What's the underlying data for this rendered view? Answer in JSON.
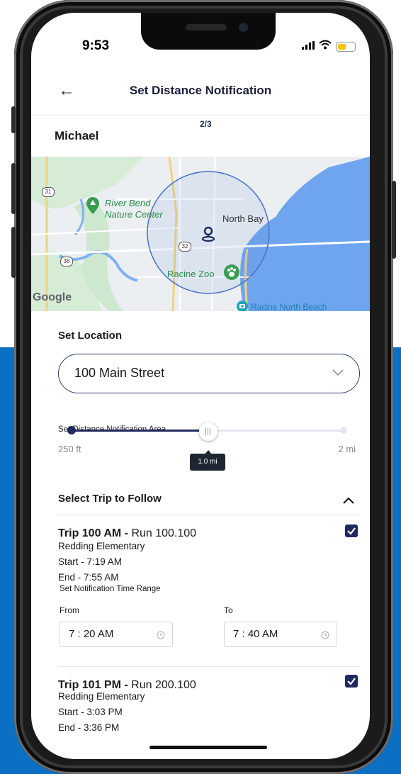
{
  "status": {
    "time": "9:53"
  },
  "header": {
    "back_icon": "back-arrow-icon",
    "title": "Set Distance Notification"
  },
  "user": {
    "name": "Michael"
  },
  "step": "2/3",
  "map": {
    "labels": {
      "river_bend_1": "River Bend",
      "river_bend_2": "Nature Center",
      "north_bay": "North Bay",
      "racine_zoo": "Racine Zoo",
      "racine_north_beach": "Racine North Beach",
      "google": "Google",
      "route_31": "31",
      "route_38": "38",
      "route_32": "32"
    }
  },
  "location": {
    "section_title": "Set Location",
    "selected": "100 Main Street"
  },
  "slider": {
    "label": "Set Distance Notification Area",
    "min": "250 ft",
    "max": "2 mi",
    "value": "1.0 mi",
    "fraction": 0.51
  },
  "trips": {
    "section_title": "Select Trip to Follow",
    "items": [
      {
        "title_bold": "Trip 100 AM - ",
        "title_rest": "Run 100.100",
        "school": "Redding Elementary",
        "start": "Start - 7:19 AM",
        "end": "End - 7:55 AM",
        "range_label": "Set Notification Time Range",
        "from_label": "From",
        "to_label": "To",
        "from_value": "7 : 20 AM",
        "to_value": "7 : 40 AM",
        "checked": true
      },
      {
        "title_bold": "Trip 101 PM - ",
        "title_rest": "Run 200.100",
        "school": "Redding Elementary",
        "start": "Start - 3:03 PM",
        "end": "End - 3:36 PM",
        "checked": true
      }
    ]
  },
  "colors": {
    "navy": "#1e2a5e",
    "background_blue": "#0b6fc4",
    "water": "#6fa5ee",
    "park_green": "#cde8cf"
  }
}
